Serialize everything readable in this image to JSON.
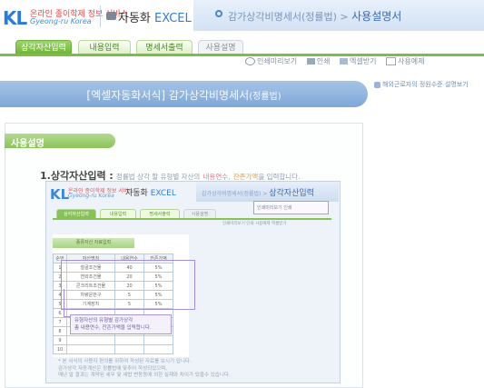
{
  "header": {
    "logo_text": "KL",
    "brand_line1": "온라인 종이학제 정보 서비스",
    "brand_line2": "Gyeong-ru Korea",
    "product_prefix": "자동화 ",
    "product_excel": "EXCEL",
    "title_main": "감가상각비명세서(정률법)",
    "title_sep": " > ",
    "title_sub": "사용설명서"
  },
  "tabs": [
    {
      "label": "상각자산입력",
      "state": "active"
    },
    {
      "label": "내용입력",
      "state": "normal"
    },
    {
      "label": "명세서출력",
      "state": "normal"
    },
    {
      "label": "사용설명",
      "state": "manual"
    }
  ],
  "toolbar": {
    "items": [
      "인쇄미리보기",
      "인쇄",
      "엑셀받기",
      "사용예제"
    ]
  },
  "banner": {
    "prefix": "[엑셀자동화서식] ",
    "title": "감가상각비명세서",
    "paren": "(정률법)"
  },
  "side_help": "해외근로자의 정원수준 설명보기",
  "section": {
    "label": "사용설명"
  },
  "step1": {
    "number": "1.",
    "title": "상각자산입력 :",
    "desc": "정률법 상각 할 유형별 자산의",
    "hl1": "내용연수",
    "comma": ",",
    "hl2": "잔존가액",
    "suffix": "을 입력합니다."
  },
  "embedded": {
    "logo_text": "KL",
    "brand_line1": "온라인 종이학제 정보 서비스",
    "brand_line2": "Gyeong-ru Korea",
    "product_prefix": "자동화 ",
    "product_excel": "EXCEL",
    "title_main": "감가상각비명세서(정률법) > ",
    "title_sub": "상각자산입력",
    "tabs": [
      "상각자산입력",
      "내용입력",
      "명세서출력",
      "사용설명"
    ],
    "toolbar_box": "인쇄미리보기  인쇄",
    "toolbar_row": "인쇄미리보기   인쇄   사용예제   엑셀받기",
    "panel_title": "종류자산 자료입력",
    "table_headers": [
      "순번",
      "자산명칭",
      "내용연수",
      "잔존가액"
    ],
    "rows": [
      [
        "1",
        "철골조건물",
        "40",
        "5%"
      ],
      [
        "2",
        "연와조건물",
        "20",
        "5%"
      ],
      [
        "3",
        "콘크리트조건물",
        "20",
        "5%"
      ],
      [
        "4",
        "차량운반구",
        "5",
        "5%"
      ],
      [
        "5",
        "기계장치",
        "5",
        "5%"
      ],
      [
        "6",
        "",
        "",
        ""
      ],
      [
        "7",
        "",
        "",
        ""
      ],
      [
        "8",
        "",
        "",
        ""
      ],
      [
        "9",
        "",
        "",
        ""
      ],
      [
        "10",
        "",
        "",
        ""
      ]
    ],
    "tooltip_line1": "유형자산의 유형별 감가상각",
    "tooltip_line2": "총 내용연수, 잔존가액을 입력합니다.",
    "notes": [
      "* 본 서식의 사용자 편의를 위하여 작성된 자료를 보시기 입니다.",
      "  감가상각 자동계산은 정률법에 맞추어 작성되었으며,",
      "  매년 말 결과는 계약된 세무 및 세법 변동등에 의한 실제와 차이가 있을수 있습니다."
    ]
  }
}
